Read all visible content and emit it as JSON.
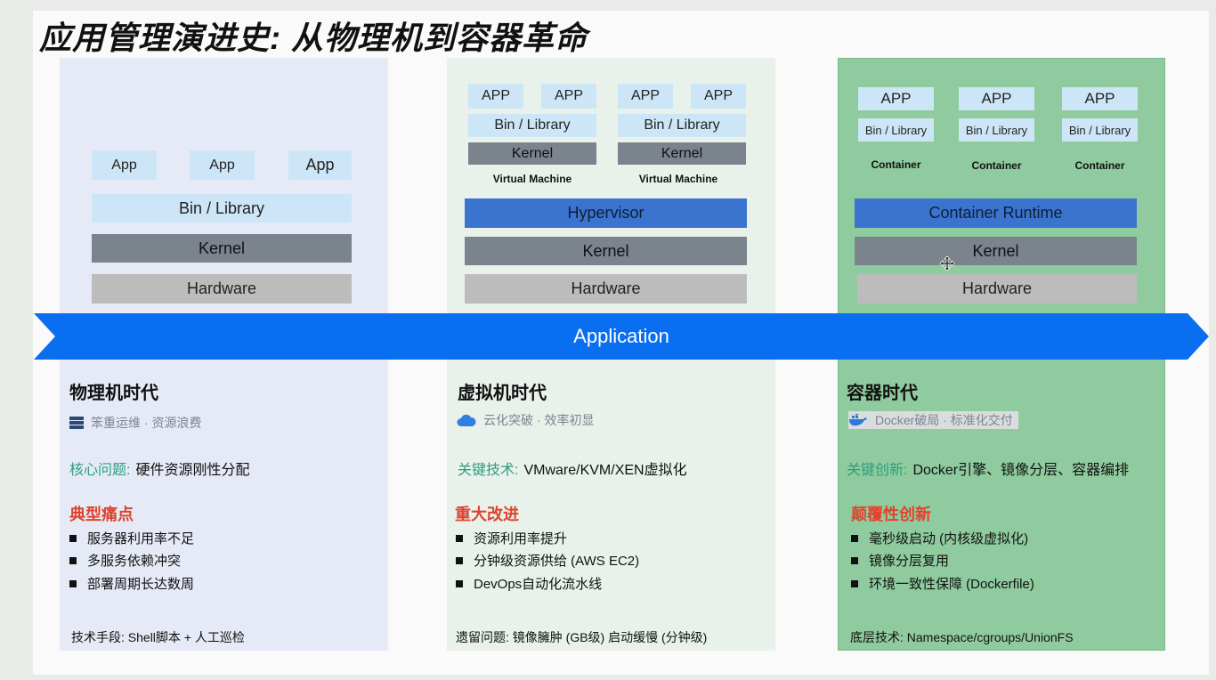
{
  "title": "应用管理演进史: 从物理机到容器革命",
  "arrow_label": "Application",
  "physical": {
    "apps": [
      "App",
      "App",
      "App"
    ],
    "bin": "Bin / Library",
    "kernel": "Kernel",
    "hardware": "Hardware",
    "era": "物理机时代",
    "tagline": "笨重运维 · 资源浪费",
    "key": "核心问题:",
    "value": "硬件资源刚性分配",
    "section": "典型痛点",
    "bullets": [
      "服务器利用率不足",
      "多服务依赖冲突",
      "部署周期长达数周"
    ],
    "footer": "技术手段: Shell脚本 + 人工巡检"
  },
  "vm": {
    "apps": [
      "APP",
      "APP",
      "APP",
      "APP"
    ],
    "bins": [
      "Bin / Library",
      "Bin / Library"
    ],
    "kernels": [
      "Kernel",
      "Kernel"
    ],
    "vm_labels": [
      "Virtual Machine",
      "Virtual Machine"
    ],
    "hypervisor": "Hypervisor",
    "kernel": "Kernel",
    "hardware": "Hardware",
    "era": "虚拟机时代",
    "tagline": "云化突破 · 效率初显",
    "key": "关键技术:",
    "value": "VMware/KVM/XEN虚拟化",
    "section": "重大改进",
    "bullets": [
      "资源利用率提升",
      "分钟级资源供给 (AWS EC2)",
      "DevOps自动化流水线"
    ],
    "footer": "遗留问题: 镜像臃肿 (GB级) 启动缓慢 (分钟级)"
  },
  "container": {
    "apps": [
      "APP",
      "APP",
      "APP"
    ],
    "bins": [
      "Bin / Library",
      "Bin / Library",
      "Bin / Library"
    ],
    "labels": [
      "Container",
      "Container",
      "Container"
    ],
    "runtime": "Container Runtime",
    "kernel": "Kernel",
    "hardware": "Hardware",
    "era": "容器时代",
    "tagline": "Docker破局 · 标准化交付",
    "key": "关键创新:",
    "value": "Docker引擎、镜像分层、容器编排",
    "section": "颠覆性创新",
    "bullets": [
      "毫秒级启动 (内核级虚拟化)",
      "镜像分层复用",
      "环境一致性保障 (Dockerfile)"
    ],
    "footer": "底层技术: Namespace/cgroups/UnionFS"
  },
  "colors": {
    "arrow": "#0a6ef0",
    "accent_green": "#2e9e80",
    "accent_red": "#e0432e",
    "container_panel": "#8fcb9e"
  },
  "icons": {
    "physical": "server-icon",
    "vm": "cloud-icon",
    "container": "docker-whale-icon"
  }
}
